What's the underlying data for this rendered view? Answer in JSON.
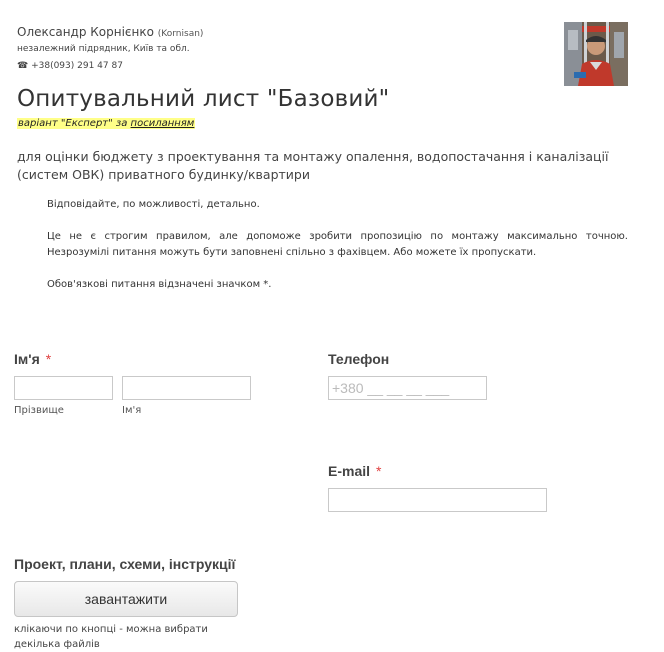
{
  "header": {
    "contractor_name": "Олександр Корнієнко",
    "contractor_nick": "(Kornisan)",
    "contractor_role": "незалежний підрядник, Київ та обл.",
    "contractor_phone": "☎ +38(093) 291 47 87"
  },
  "form": {
    "title": "Опитувальний лист \"Базовий\"",
    "variant_prefix": "варіант \"Експерт\" за ",
    "variant_link": "посиланням",
    "subtitle": "для оцінки бюджету з проектування та монтажу опалення, водопостачання і каналізації (систем ОВК) приватного будинку/квартири",
    "notes": [
      "Відповідайте, по можливості, детально.",
      "Це не є строгим правилом, але допоможе зробити пропозицію по монтажу максимально точною. Незрозумілі питання можуть бути заповнені спільно з фахівцем. Або можете їх пропускати.",
      "Обов'язкові питання відзначені значком *."
    ]
  },
  "fields": {
    "name_label": "Ім'я",
    "required_mark": "*",
    "surname_sublabel": "Прізвище",
    "firstname_sublabel": "Ім'я",
    "surname_value": "",
    "firstname_value": "",
    "phone_label": "Телефон",
    "phone_placeholder": "+380 __ __ __ ___",
    "email_label": "E-mail",
    "email_value": "",
    "upload_label": "Проект, плани, схеми, інструкції",
    "upload_button": "завантажити",
    "upload_hint": "клікаючи по кнопці - можна вибрати декілька файлів"
  },
  "colors": {
    "required": "#e04040",
    "highlight": "#ffff88"
  }
}
